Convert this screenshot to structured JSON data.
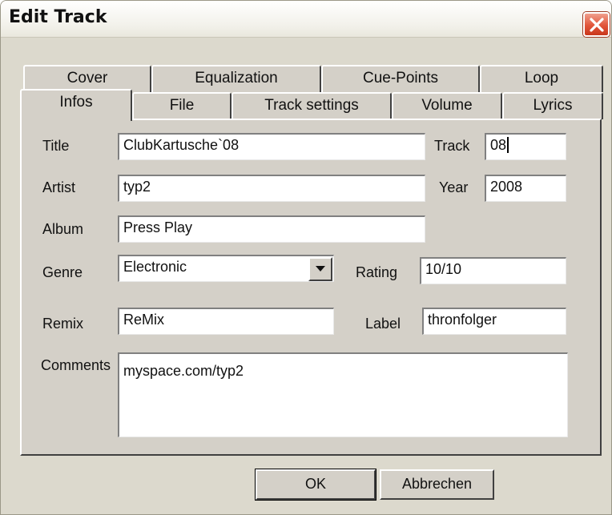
{
  "window": {
    "title": "Edit Track"
  },
  "tabs": {
    "row1": [
      "Cover",
      "Equalization",
      "Cue-Points",
      "Loop"
    ],
    "row2": [
      "Infos",
      "File",
      "Track settings",
      "Volume",
      "Lyrics"
    ],
    "active": "Infos"
  },
  "form": {
    "title_label": "Title",
    "title_value": "ClubKartusche`08",
    "track_label": "Track",
    "track_value": "08",
    "artist_label": "Artist",
    "artist_value": "typ2",
    "year_label": "Year",
    "year_value": "2008",
    "album_label": "Album",
    "album_value": "Press Play",
    "genre_label": "Genre",
    "genre_value": "Electronic",
    "rating_label": "Rating",
    "rating_value": "10/10",
    "remix_label": "Remix",
    "remix_value": "ReMix",
    "label_label": "Label",
    "label_value": "thronfolger",
    "comments_label": "Comments",
    "comments_value": "myspace.com/typ2"
  },
  "buttons": {
    "ok": "OK",
    "cancel": "Abbrechen"
  },
  "colors": {
    "face": "#d4d0c8",
    "close_red": "#e2553a"
  }
}
